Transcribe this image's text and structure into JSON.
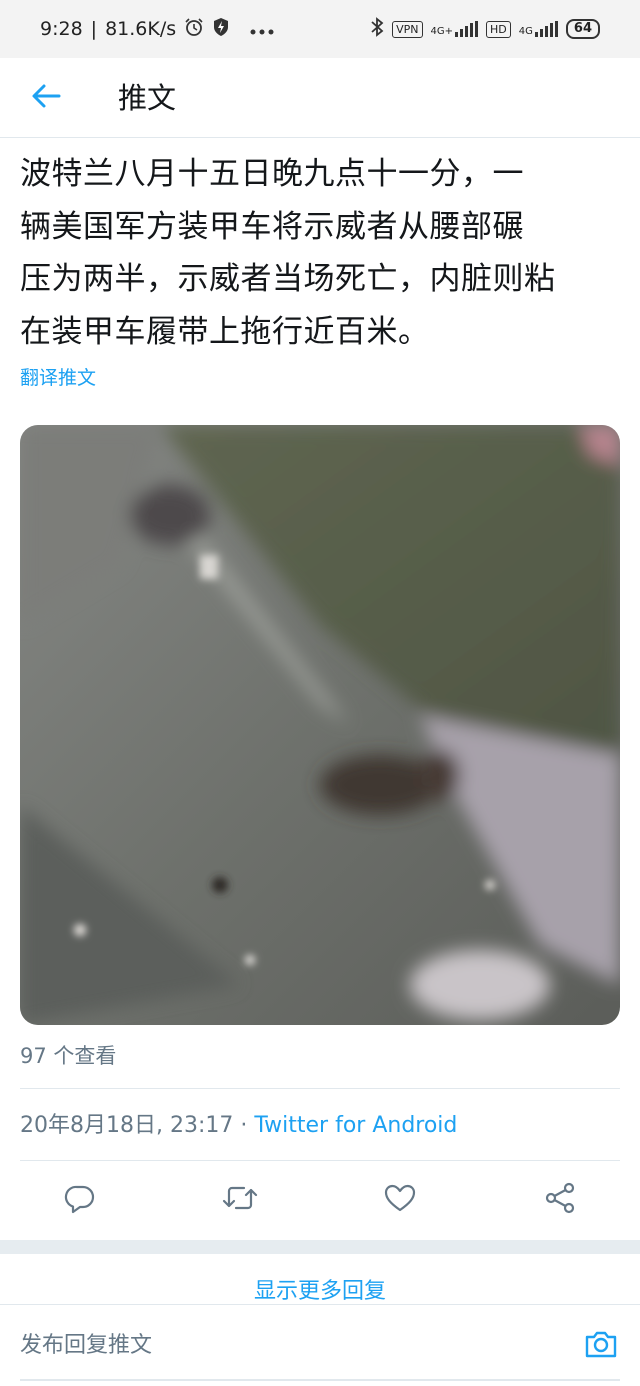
{
  "status_bar": {
    "time": "9:28",
    "speed": "81.6K/s",
    "vpn_label": "VPN",
    "network_label": "4G+",
    "hd_label": "HD",
    "network2_label": "4G",
    "battery": "64",
    "icons": [
      "alarm-icon",
      "shield-bolt-icon",
      "more-dots-icon",
      "bluetooth-icon",
      "signal-icon",
      "signal-icon"
    ]
  },
  "header": {
    "back_icon": "arrow-left-icon",
    "title": "推文"
  },
  "tweet": {
    "text_lines": [
      "波特兰八月十五日晚九点十一分，一",
      "辆美国军方装甲车将示威者从腰部碾",
      "压为两半，示威者当场死亡，内脏则粘",
      "在装甲车履带上拖行近百米。"
    ],
    "translate_label": "翻译推文",
    "views": "97 个查看",
    "date": "20年8月18日, 23:17",
    "separator": " · ",
    "source": "Twitter for Android"
  },
  "actions": {
    "reply_icon": "reply-bubble-icon",
    "retweet_icon": "retweet-icon",
    "like_icon": "heart-icon",
    "share_icon": "share-icon"
  },
  "more_replies_label": "显示更多回复",
  "reply_bar": {
    "placeholder": "发布回复推文",
    "camera_icon": "camera-icon"
  },
  "colors": {
    "accent": "#1da1f2",
    "secondary_text": "#657786",
    "divider": "#e1e8ed"
  }
}
